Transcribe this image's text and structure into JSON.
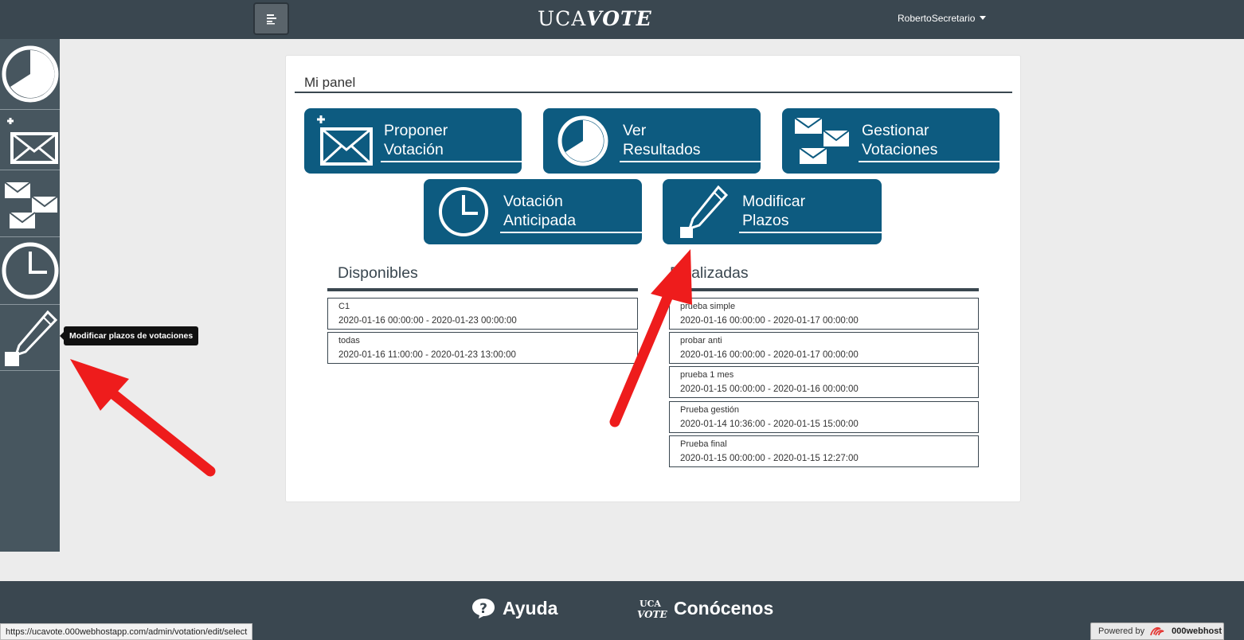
{
  "header": {
    "brand_prefix": "UCA",
    "brand_suffix": "VOTE",
    "user_name": "RobertoSecretario"
  },
  "sidebar": {
    "items": [
      {
        "name": "ver-resultados",
        "icon": "pie-chart-icon"
      },
      {
        "name": "proponer-votacion",
        "icon": "new-envelope-icon"
      },
      {
        "name": "gestionar-votaciones",
        "icon": "envelopes-icon"
      },
      {
        "name": "votacion-anticipada",
        "icon": "clock-icon"
      },
      {
        "name": "modificar-plazos",
        "icon": "pencil-icon"
      }
    ],
    "tooltip": "Modificar plazos de votaciones"
  },
  "panel": {
    "title": "Mi panel",
    "tiles": [
      {
        "line1": "Proponer",
        "line2": "Votación",
        "icon": "new-envelope-icon"
      },
      {
        "line1": "Ver",
        "line2": "Resultados",
        "icon": "pie-chart-icon"
      },
      {
        "line1": "Gestionar",
        "line2": "Votaciones",
        "icon": "envelopes-icon"
      },
      {
        "line1": "Votación",
        "line2": "Anticipada",
        "icon": "clock-icon"
      },
      {
        "line1": "Modificar",
        "line2": "Plazos",
        "icon": "pencil-icon"
      }
    ],
    "disponibles": {
      "title": "Disponibles",
      "items": [
        {
          "name": "C1",
          "dates": "2020-01-16 00:00:00 - 2020-01-23 00:00:00"
        },
        {
          "name": "todas",
          "dates": "2020-01-16 11:00:00 - 2020-01-23 13:00:00"
        }
      ]
    },
    "finalizadas": {
      "title": "Finalizadas",
      "items": [
        {
          "name": "prueba simple",
          "dates": "2020-01-16 00:00:00 - 2020-01-17 00:00:00"
        },
        {
          "name": "probar anti",
          "dates": "2020-01-16 00:00:00 - 2020-01-17 00:00:00"
        },
        {
          "name": "prueba 1 mes",
          "dates": "2020-01-15 00:00:00 - 2020-01-16 00:00:00"
        },
        {
          "name": "Prueba gestión",
          "dates": "2020-01-14 10:36:00 - 2020-01-15 15:00:00"
        },
        {
          "name": "Prueba final",
          "dates": "2020-01-15 00:00:00 - 2020-01-15 12:27:00"
        }
      ]
    }
  },
  "footer": {
    "help": "Ayuda",
    "about": "Conócenos",
    "about_logo_top": "UCA",
    "about_logo_bottom": "VOTE"
  },
  "statusbar": {
    "url": "https://ucavote.000webhostapp.com/admin/votation/edit/select"
  },
  "powered": {
    "prefix": "Powered by",
    "brand": "000webhost"
  },
  "colors": {
    "topbar": "#3a4750",
    "sidebar": "#47565f",
    "tile": "#0d5b80",
    "arrow": "#ee1c1c"
  }
}
